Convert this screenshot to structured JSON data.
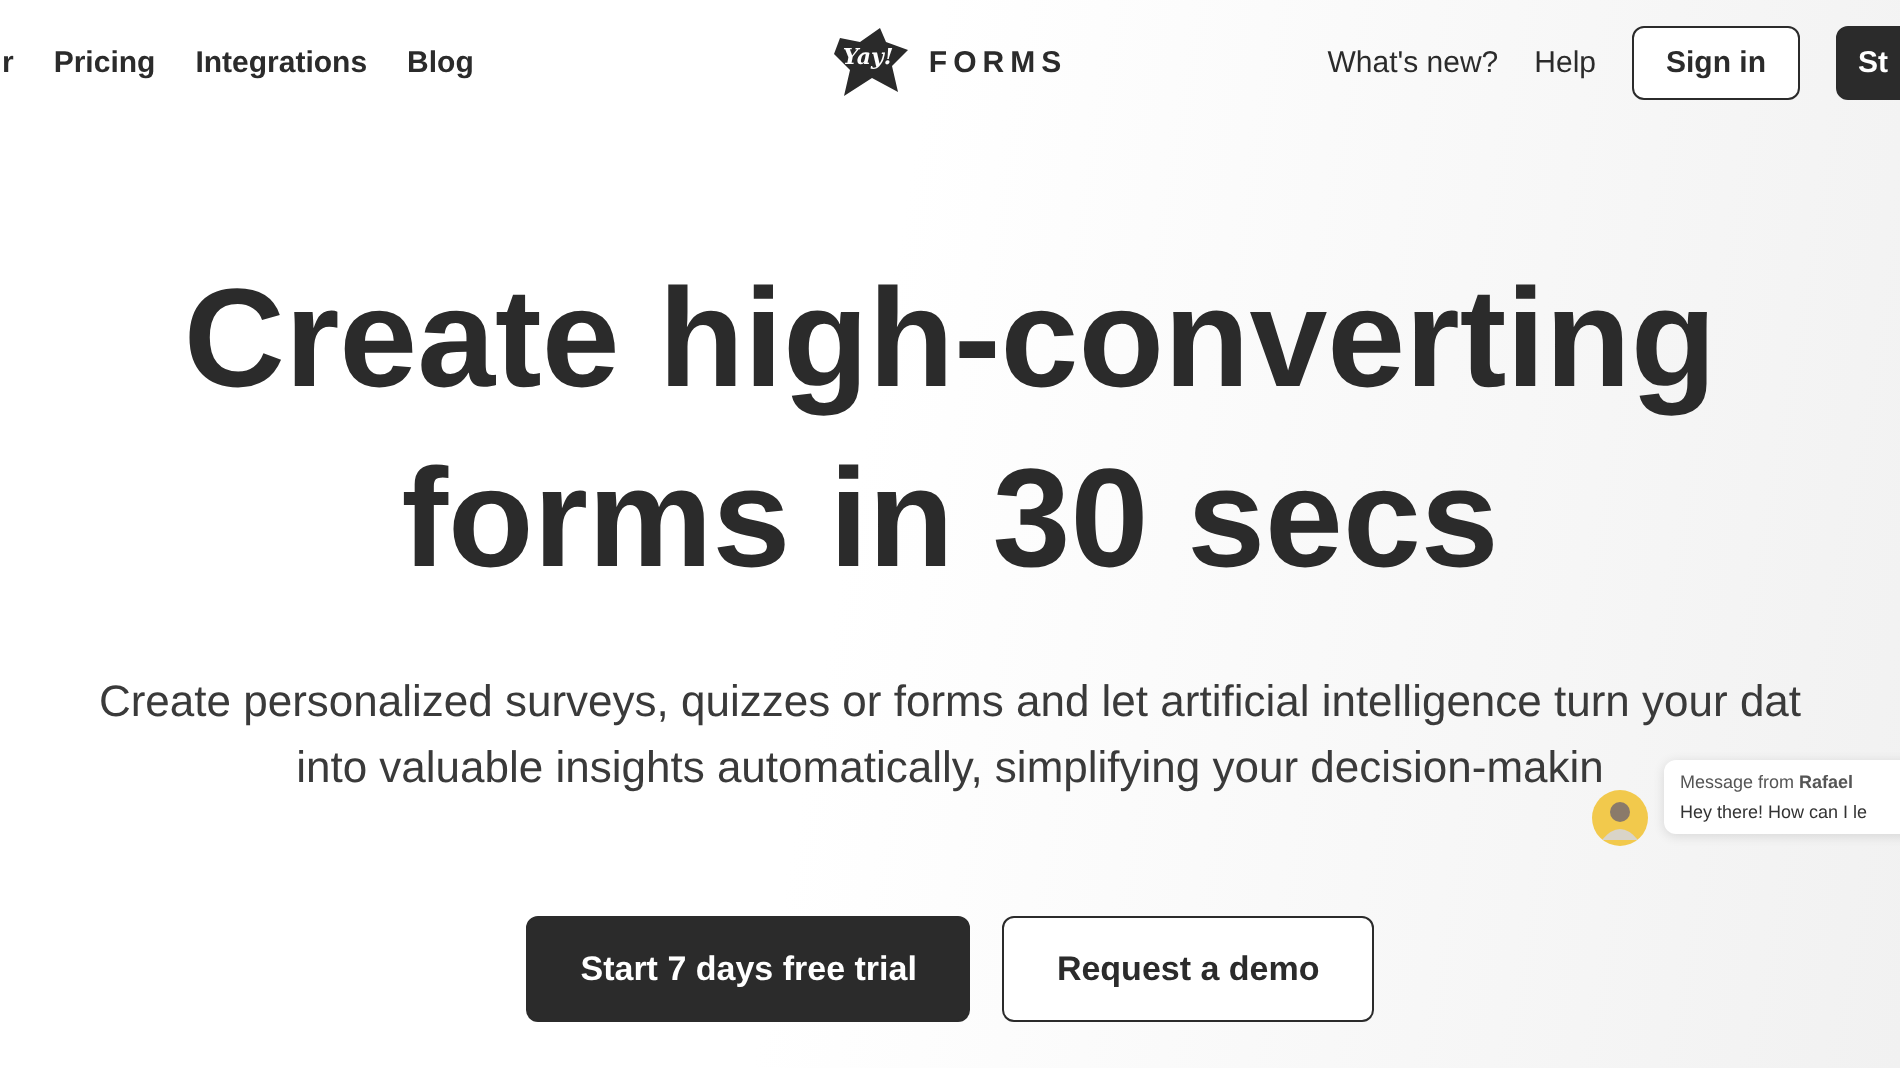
{
  "nav_left": [
    {
      "label": "r"
    },
    {
      "label": "Pricing"
    },
    {
      "label": "Integrations"
    },
    {
      "label": "Blog"
    }
  ],
  "logo": {
    "mark": "Yay!",
    "text": "FORMS"
  },
  "nav_right": [
    {
      "label": "What's new?",
      "kind": "link"
    },
    {
      "label": "Help",
      "kind": "link"
    },
    {
      "label": "Sign in",
      "kind": "outline"
    },
    {
      "label": "St",
      "kind": "solid"
    }
  ],
  "hero": {
    "headline": [
      "Create high-converting",
      "forms in 30 secs"
    ],
    "subtitle": [
      "Create personalized surveys, quizzes or forms and let artificial intelligence turn your dat",
      "into valuable insights automatically, simplifying your decision-makin"
    ]
  },
  "actions": [
    {
      "label": "Start 7 days free trial",
      "kind": "solid"
    },
    {
      "label": "Request a demo",
      "kind": "outline"
    }
  ],
  "chat": {
    "from_label": "Message from",
    "sender": "Rafael",
    "message": "Hey there! How can I le"
  }
}
